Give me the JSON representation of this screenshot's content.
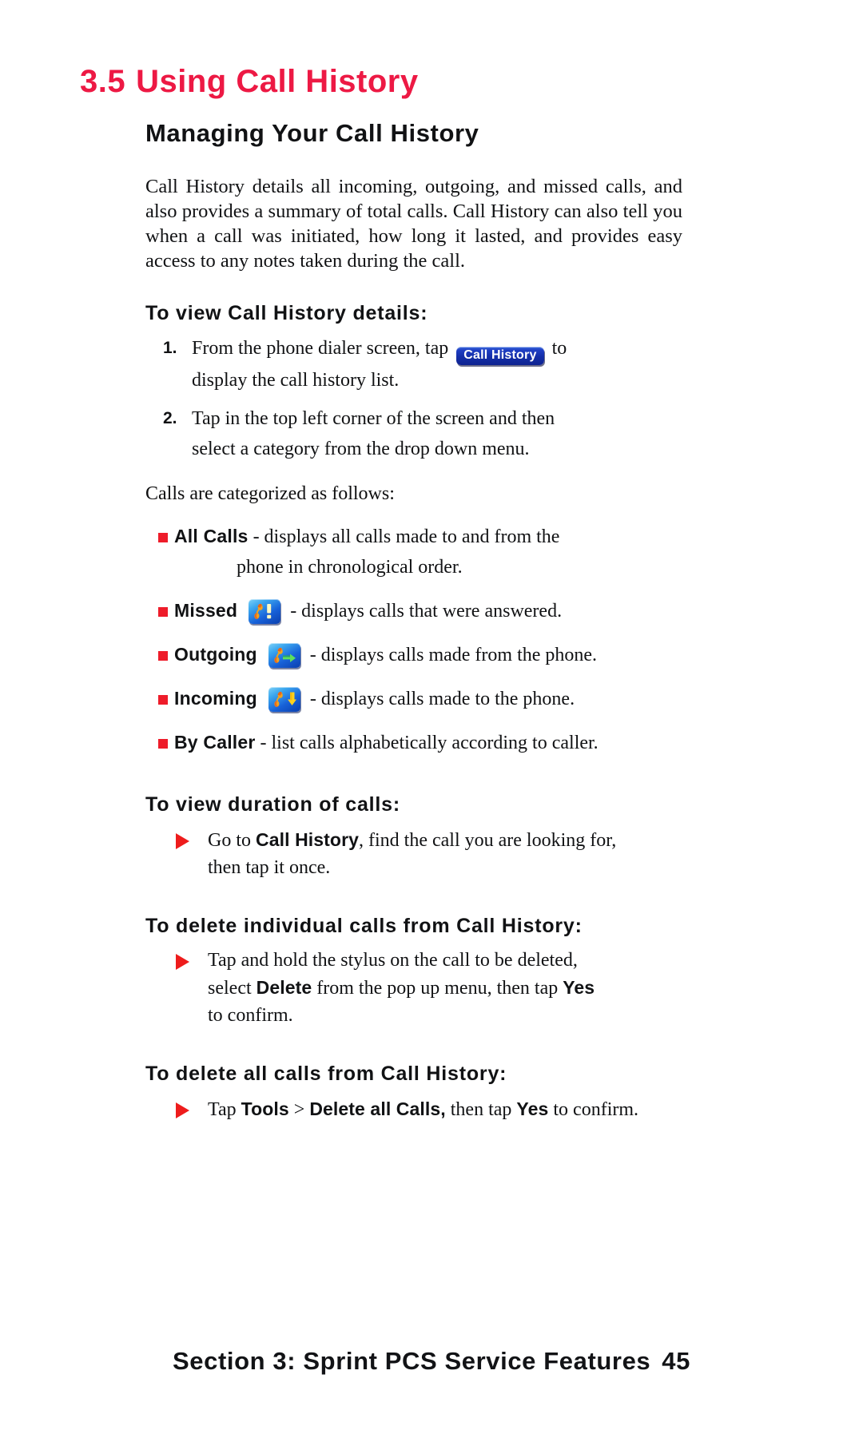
{
  "page": {
    "chapter_number": "3.5",
    "chapter_title": "Using Call History",
    "accent_color": "#ed1944",
    "bullet_square_color": "#ee1c2a",
    "bullet_triangle_color": "#ee1c1c",
    "background_color": "#ffffff"
  },
  "section": {
    "heading": "Managing Your Call History",
    "intro_paragraph": "Call History details all incoming, outgoing, and missed calls, and also provides a summary of total calls. Call History can also tell you when a call was initiated, how long it lasted, and provides easy access to any notes taken during the call."
  },
  "view_details": {
    "heading": "To view Call History details:",
    "steps": [
      {
        "number": "1.",
        "text_before": "From the phone dialer screen, tap",
        "inline_button": "Call History",
        "text_after": "to",
        "continuation": "display the call history list."
      },
      {
        "number": "2.",
        "text_before": "Tap in the top left corner of the screen and then",
        "inline_button": "",
        "text_after": "",
        "continuation": "select a category from the drop down menu."
      }
    ]
  },
  "categories": {
    "lead_in": "Calls are categorized as follows:",
    "items": [
      {
        "name": "All Calls",
        "icon": "",
        "description": "- displays all calls made to and from the",
        "continuation": "phone in chronological order."
      },
      {
        "name": "Missed",
        "icon": "missed-call-icon",
        "description": "- displays calls that were answered.",
        "continuation": ""
      },
      {
        "name": "Outgoing",
        "icon": "outgoing-call-icon",
        "description": "- displays calls made from the phone.",
        "continuation": ""
      },
      {
        "name": "Incoming",
        "icon": "incoming-call-icon",
        "description": "- displays calls made to the phone.",
        "continuation": ""
      },
      {
        "name": "By Caller",
        "icon": "",
        "description": "- list calls alphabetically according to caller.",
        "continuation": ""
      }
    ]
  },
  "duration": {
    "heading": "To view duration of calls:",
    "action_line_1": "Go to",
    "action_bold_1": "Call History",
    "action_line_2": ", find the call you are looking for,",
    "action_continuation": "then tap it once."
  },
  "delete_individual": {
    "heading": "To delete individual calls from Call History:",
    "line_1": "Tap and hold the stylus on the call to be deleted,",
    "line_2_a": "select",
    "line_2_bold_a": "Delete",
    "line_2_b": "from the pop up menu, then tap",
    "line_2_bold_b": "Yes",
    "line_3": "to confirm."
  },
  "delete_all": {
    "heading": "To delete all calls from Call History:",
    "line_a": "Tap",
    "line_bold_a": "Tools",
    "line_b": ">",
    "line_bold_b": "Delete all Calls,",
    "line_c": "then tap",
    "line_bold_c": "Yes",
    "line_d": "to confirm."
  },
  "footer": {
    "text": "Section 3: Sprint PCS Service Features",
    "page_number": "45"
  }
}
